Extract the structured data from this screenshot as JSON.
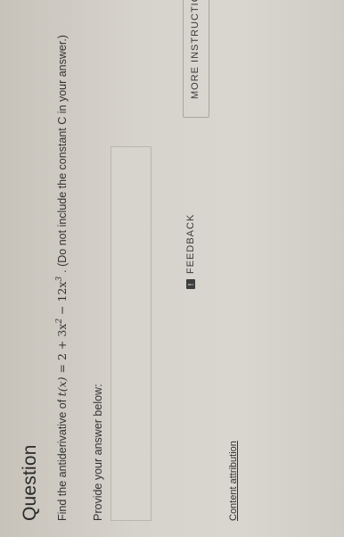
{
  "question": {
    "heading": "Question",
    "prompt_prefix": "Find the antiderivative of",
    "function_lhs": "t(x)",
    "function_rhs_parts": [
      "= 2 + 3x",
      "2",
      " − 12x",
      "3"
    ],
    "prompt_suffix": ". (Do not include the constant C in your answer.)"
  },
  "answer": {
    "label": "Provide your answer below:",
    "value": ""
  },
  "actions": {
    "feedback_icon": "!",
    "feedback_label": "FEEDBACK",
    "more_label": "MORE INSTRUCTIC"
  },
  "footer": {
    "attribution": "Content attribution"
  }
}
